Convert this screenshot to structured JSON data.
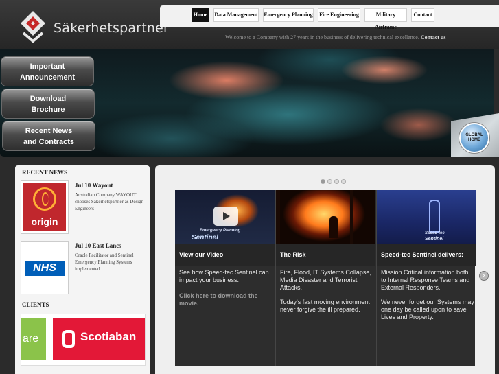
{
  "brand": {
    "name": "Säkerhetspartner",
    "logo_icon": "house-diamond-logo-icon"
  },
  "nav": {
    "items": [
      {
        "label": "Home",
        "active": true
      },
      {
        "label": "Data Management",
        "active": false
      },
      {
        "label": "Emergency Planning",
        "active": false
      },
      {
        "label": "Fire Engineering",
        "active": false
      },
      {
        "label": "Military Airframe",
        "active": false
      },
      {
        "label": "Contact",
        "active": false
      }
    ]
  },
  "welcome": {
    "text": "Welcome to a Company with 27 years in the business of delivering technical excellence.",
    "contact_link": "Contact us"
  },
  "banner": {
    "buttons": [
      {
        "line1": "Important",
        "line2": "Announcement"
      },
      {
        "line1": "Download",
        "line2": "Brochure"
      },
      {
        "line1": "Recent News",
        "line2": "and Contracts"
      }
    ],
    "badge": {
      "line1": "GLOBAL",
      "line2": "HOME"
    }
  },
  "sidebar": {
    "recent_news_heading": "RECENT NEWS",
    "news": [
      {
        "title": "Jul 10 Wayout",
        "text": "Australian Company WAYOUT chooses Säkerhetspartner as Design Engineers",
        "logo_word": "origin"
      },
      {
        "title": "Jul 10 East Lancs",
        "text": "Oracle Facilitator and Sentinel Emergency Planning Systems implemented.",
        "logo_word": "NHS"
      }
    ],
    "clients_heading": "CLIENTS",
    "clients": [
      {
        "word": "are"
      },
      {
        "word": "Scotiaban"
      }
    ]
  },
  "slider": {
    "dots": [
      {
        "active": true
      },
      {
        "active": false
      },
      {
        "active": false
      },
      {
        "active": false
      }
    ],
    "columns": [
      {
        "heading": "View our Video",
        "paragraphs": [
          "See how Speed-tec Sentinel can impact your business."
        ],
        "link": "Click here to download the movie.",
        "image_caption_large": "Sentinel",
        "image_caption_small": "Emergency Planning"
      },
      {
        "heading": "The Risk",
        "paragraphs": [
          "Fire, Flood, IT Systems Collapse, Media Disaster and Terrorist Attacks.",
          "Today's fast moving environment never forgive the ill prepared."
        ]
      },
      {
        "heading": "Speed-tec Sentinel delivers:",
        "paragraphs": [
          "Mission Critical information both to Internal Response Teams and External Responders.",
          "We never forget our Systems may one day be called upon to save Lives and Property."
        ],
        "image_caption_large": "Sentinel",
        "image_caption_small": "Speed-tec"
      }
    ],
    "next_arrow": "›"
  },
  "colors": {
    "nav_active": "#111111",
    "brochure_red": "#c0272d",
    "nhs_blue": "#005eb8",
    "scotia_red": "#e31837"
  }
}
